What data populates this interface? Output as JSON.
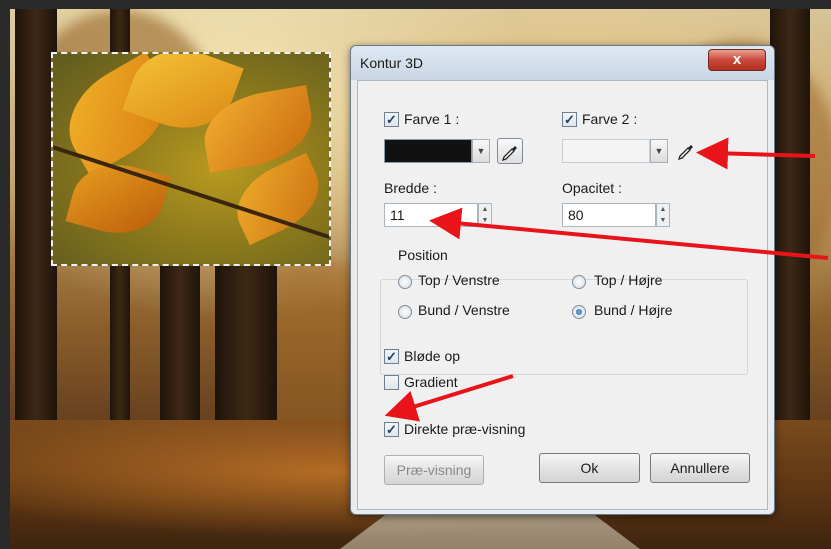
{
  "dialog": {
    "title": "Kontur 3D",
    "close_label": "x",
    "color1": {
      "label": "Farve 1 :",
      "checked": true,
      "swatch": "#111111"
    },
    "color2": {
      "label": "Farve 2 :",
      "checked": true,
      "swatch": "#f4f4f4"
    },
    "width": {
      "label": "Bredde :",
      "value": "11"
    },
    "opacity": {
      "label": "Opacitet :",
      "value": "80"
    },
    "position": {
      "label": "Position",
      "options": [
        {
          "label": "Top / Venstre",
          "selected": false
        },
        {
          "label": "Top / Højre",
          "selected": false
        },
        {
          "label": "Bund / Venstre",
          "selected": false
        },
        {
          "label": "Bund / Højre",
          "selected": true
        }
      ]
    },
    "soften": {
      "label": "Bløde op",
      "checked": true
    },
    "gradient": {
      "label": "Gradient",
      "checked": false
    },
    "live_preview": {
      "label": "Direkte præ-visning",
      "checked": true
    },
    "buttons": {
      "preview": "Præ-visning",
      "ok": "Ok",
      "cancel": "Annullere"
    },
    "check_mark": "✓"
  },
  "colors": {
    "arrow": "#e8141a",
    "accent": "#1c5aa6"
  },
  "icons": [
    "eyedropper-icon",
    "chevron-down-icon",
    "spinner-up-icon",
    "spinner-down-icon",
    "close-icon"
  ]
}
